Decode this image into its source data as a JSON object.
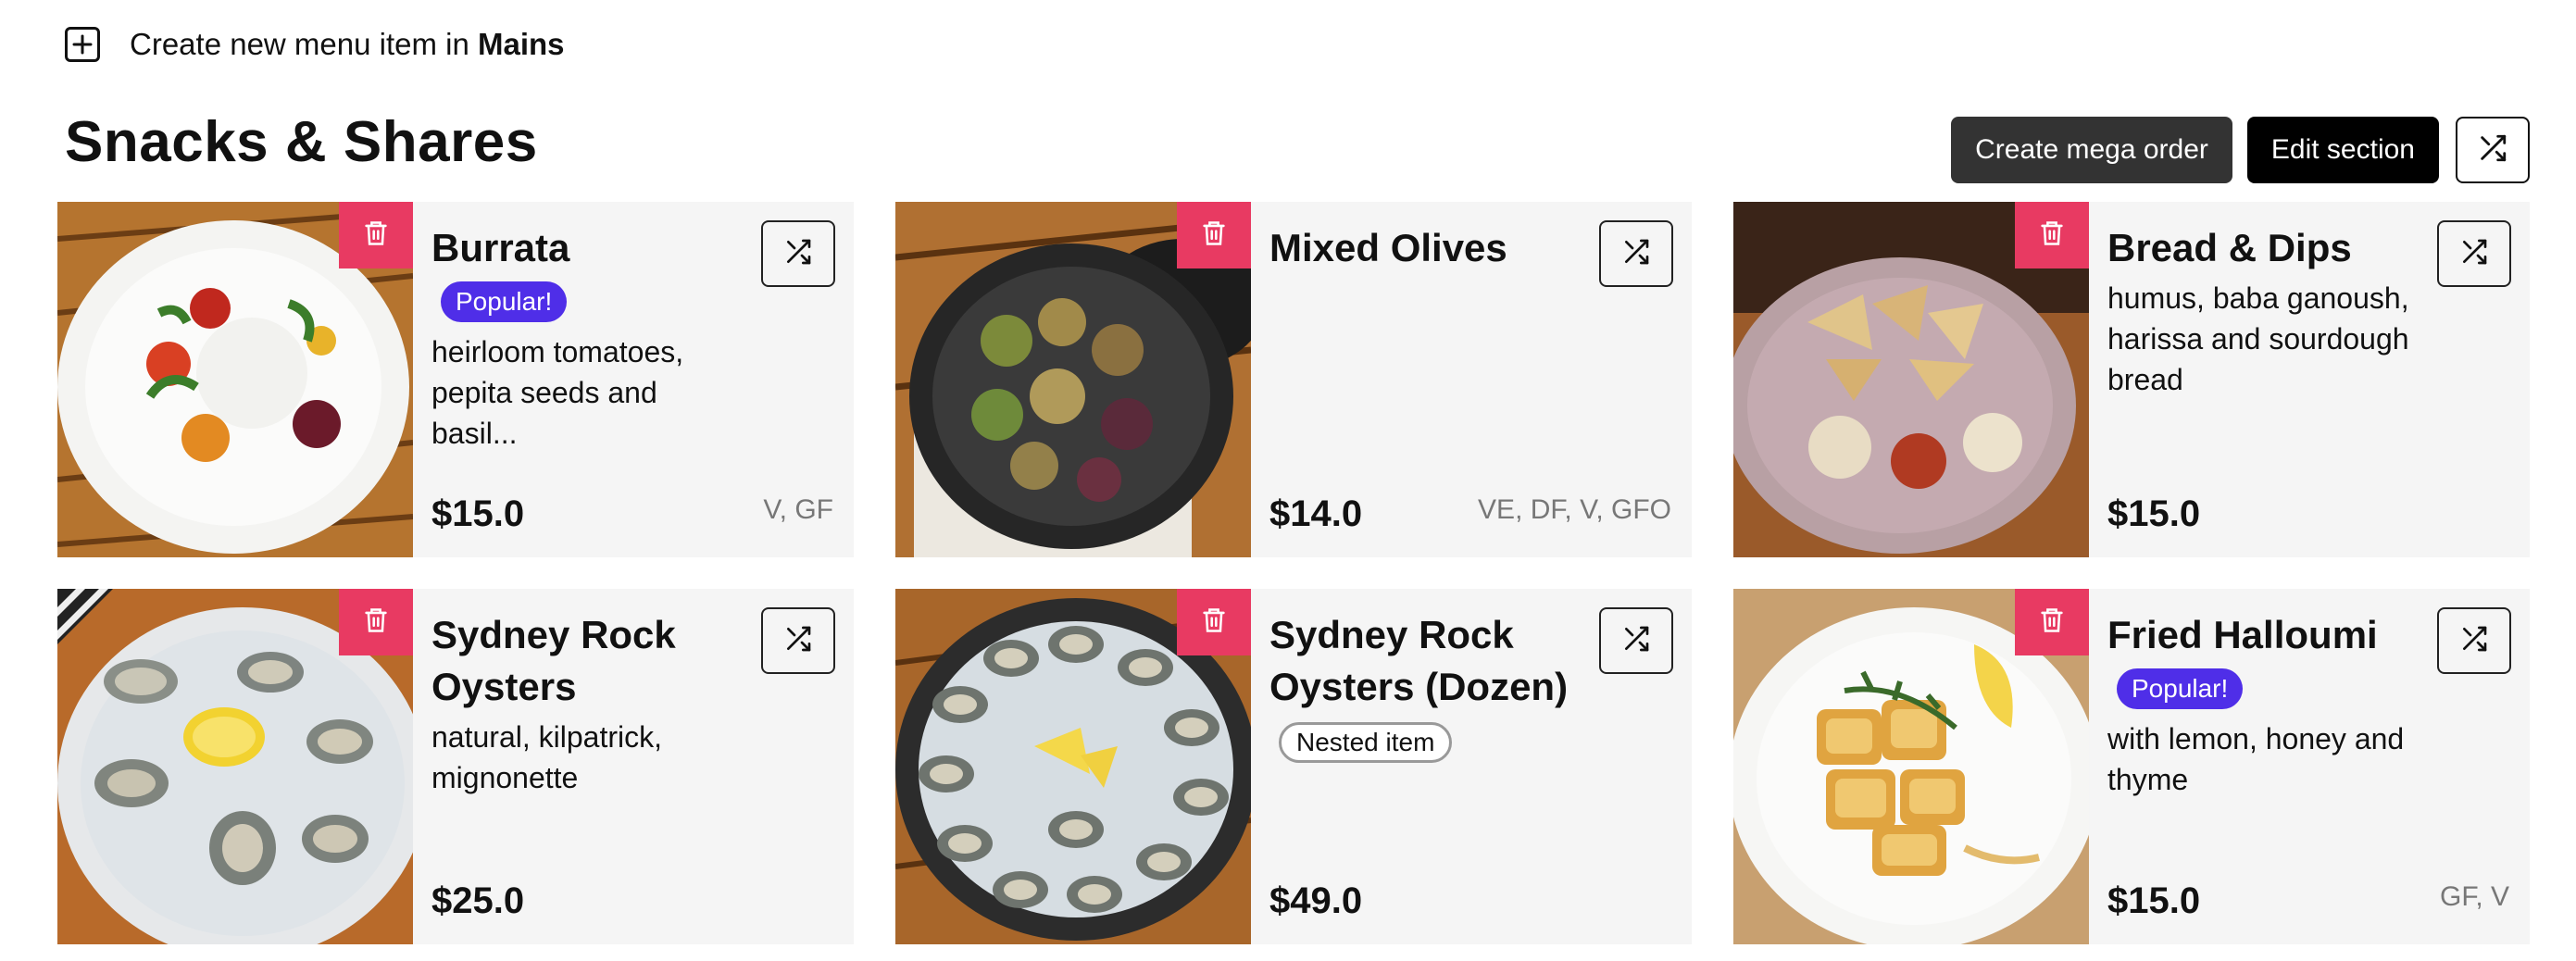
{
  "topbar": {
    "create_label": "Create new menu item in ",
    "section_name": "Mains"
  },
  "section": {
    "title": "Snacks & Shares",
    "mega_order_label": "Create mega order",
    "edit_label": "Edit section"
  },
  "colors": {
    "delete_bg": "#e83a62",
    "popular_badge": "#4f2ee8",
    "card_bg": "#f5f5f5"
  },
  "items": [
    {
      "name": "Burrata",
      "badge": "Popular!",
      "desc": "heirloom tomatoes, pepita seeds and basil...",
      "price": "$15.0",
      "tags": "V, GF",
      "photo": "burrata"
    },
    {
      "name": "Mixed Olives",
      "badge": "",
      "desc": "",
      "price": "$14.0",
      "tags": "VE, DF, V, GFO",
      "photo": "olives"
    },
    {
      "name": "Bread & Dips",
      "badge": "",
      "desc": "humus, baba ganoush, harissa and sourdough bread",
      "price": "$15.0",
      "tags": "",
      "photo": "bread"
    },
    {
      "name": "Sydney Rock Oysters",
      "badge": "",
      "desc": "natural, kilpatrick, mignonette",
      "price": "$25.0",
      "tags": "",
      "photo": "oysters"
    },
    {
      "name": "Sydney Rock Oysters (Dozen)",
      "nested": "Nested item",
      "desc": "",
      "price": "$49.0",
      "tags": "",
      "photo": "oysters-dozen"
    },
    {
      "name": "Fried Halloumi",
      "badge": "Popular!",
      "desc": "with lemon, honey and thyme",
      "price": "$15.0",
      "tags": "GF, V",
      "photo": "halloumi"
    }
  ]
}
